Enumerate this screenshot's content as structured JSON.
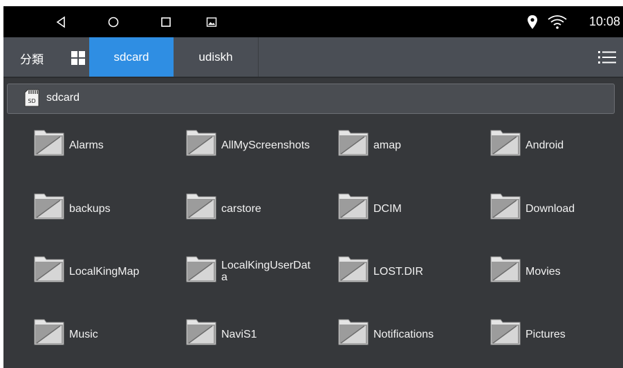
{
  "status_bar": {
    "time": "10:08",
    "icons": [
      "back-icon",
      "home-icon",
      "recents-icon",
      "gallery-icon",
      "location-icon",
      "wifi-icon"
    ]
  },
  "tab_bar": {
    "category_label": "分類",
    "tabs": [
      {
        "label": "sdcard",
        "active": true
      },
      {
        "label": "udiskh",
        "active": false
      }
    ]
  },
  "path_bar": {
    "icon_text": "SD",
    "label": "sdcard"
  },
  "folders": [
    "Alarms",
    "AllMyScreenshots",
    "amap",
    "Android",
    "backups",
    "carstore",
    "DCIM",
    "Download",
    "LocalKingMap",
    "LocalKingUserData",
    "LOST.DIR",
    "Movies",
    "Music",
    "NaviS1",
    "Notifications",
    "Pictures"
  ],
  "colors": {
    "accent": "#2f8ee3",
    "background": "#36383b",
    "tab_bar": "#4a4e55"
  }
}
